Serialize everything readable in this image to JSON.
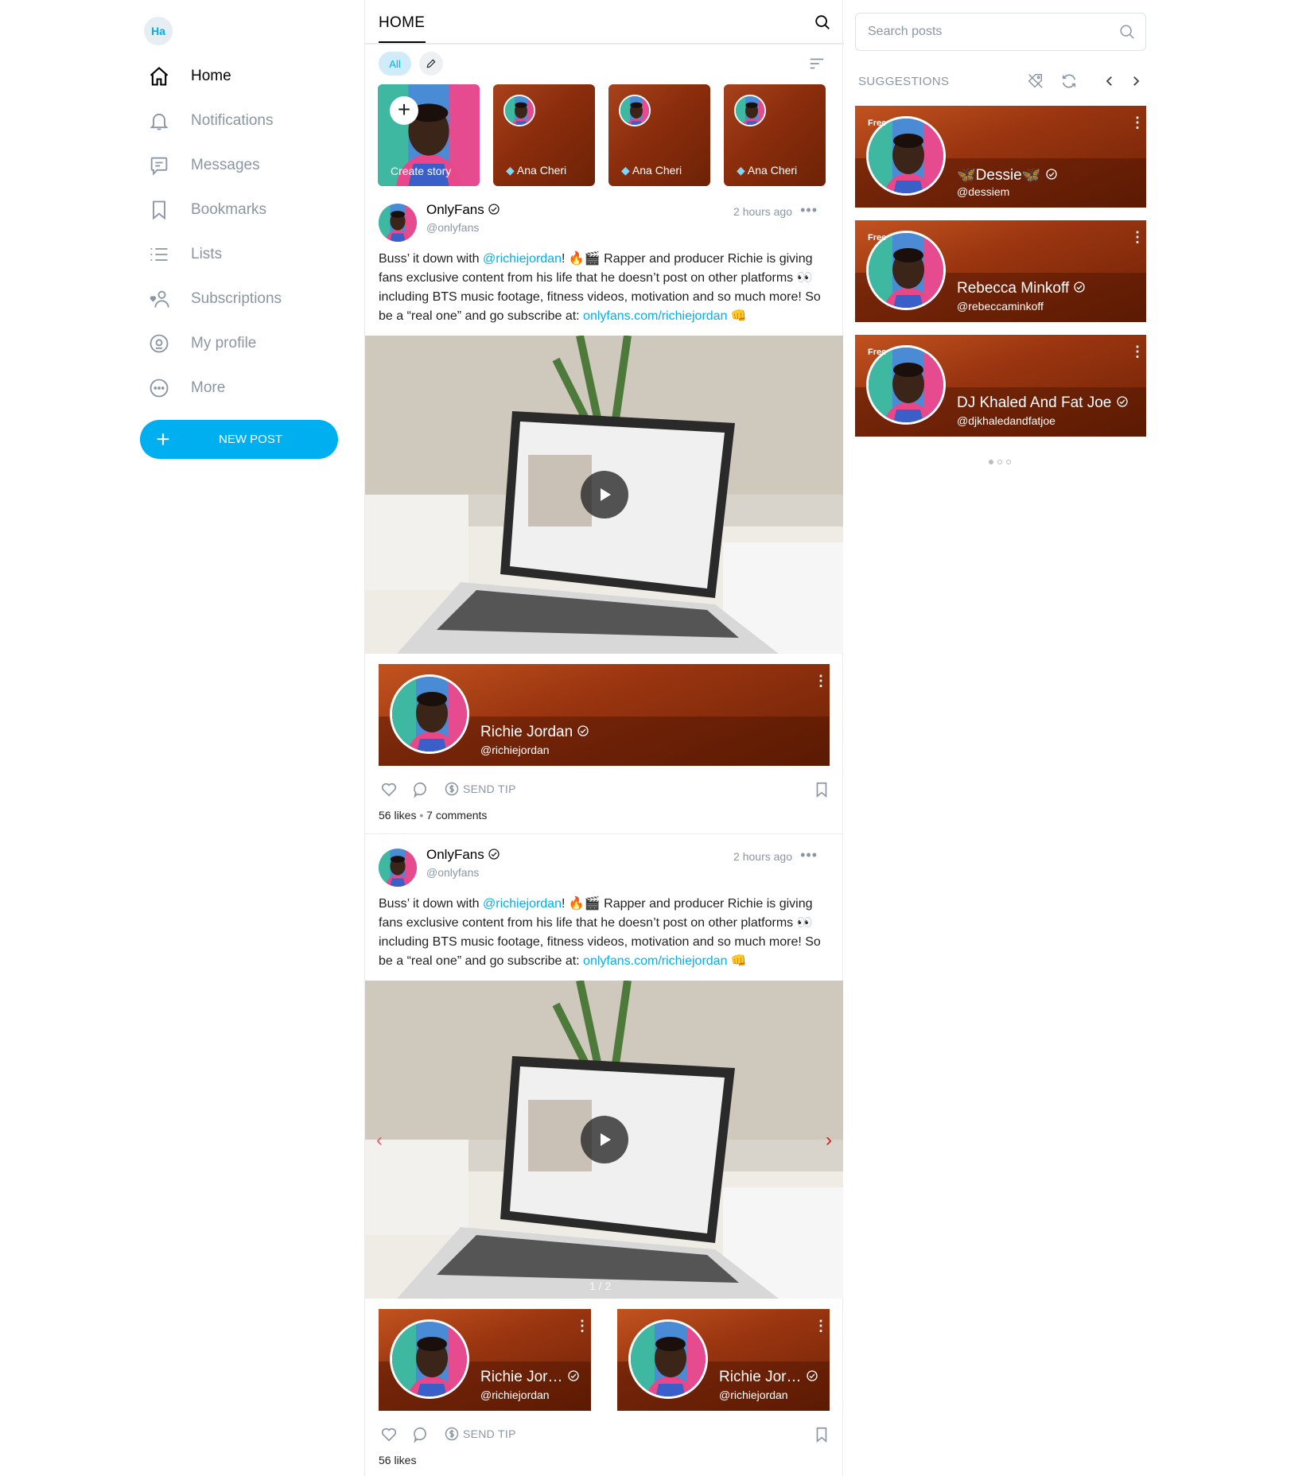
{
  "sidebar": {
    "avatar_initials": "Ha",
    "items": [
      {
        "label": "Home",
        "icon": "home-icon"
      },
      {
        "label": "Notifications",
        "icon": "bell-icon"
      },
      {
        "label": "Messages",
        "icon": "message-icon"
      },
      {
        "label": "Bookmarks",
        "icon": "bookmark-icon"
      },
      {
        "label": "Lists",
        "icon": "list-icon"
      },
      {
        "label": "Subscriptions",
        "icon": "subscriptions-icon"
      },
      {
        "label": "My profile",
        "icon": "profile-icon"
      },
      {
        "label": "More",
        "icon": "more-icon"
      }
    ],
    "new_post_label": "NEW POST"
  },
  "main": {
    "title": "HOME",
    "filter_all": "All",
    "stories": [
      {
        "label": "Create story"
      },
      {
        "label": "Ana Cheri"
      },
      {
        "label": "Ana Cheri"
      },
      {
        "label": "Ana Cheri"
      }
    ],
    "posts": [
      {
        "author": "OnlyFans",
        "handle": "@onlyfans",
        "time": "2 hours ago",
        "text_pre": "Buss’ it down with ",
        "mention": "@richiejordan",
        "text_mid": "! 🔥🎬 Rapper and producer Richie is giving fans exclusive content from his life that he doesn’t post on other platforms 👀 including BTS music footage, fitness videos, motivation and so much more! So be a “real one” and go subscribe at: ",
        "link": "onlyfans.com/richiejordan",
        "text_post": " 👊",
        "cards": [
          {
            "name": "Richie Jordan",
            "handle": "@richiejordan"
          }
        ],
        "send_tip": "SEND TIP",
        "likes": "56 likes",
        "comments": "7 comments"
      },
      {
        "author": "OnlyFans",
        "handle": "@onlyfans",
        "time": "2 hours ago",
        "text_pre": "Buss’ it down with ",
        "mention": "@richiejordan",
        "text_mid": "! 🔥🎬 Rapper and producer Richie is giving fans exclusive content from his life that he doesn’t post on other platforms 👀 including BTS music footage, fitness videos, motivation and so much more! So be a “real one” and go subscribe at: ",
        "link": "onlyfans.com/richiejordan",
        "text_post": " 👊",
        "media_counter": "1 / 2",
        "cards": [
          {
            "name": "Richie Jor…",
            "handle": "@richiejordan"
          },
          {
            "name": "Richie Jor…",
            "handle": "@richiejordan"
          }
        ],
        "send_tip": "SEND TIP",
        "likes": "56 likes"
      }
    ]
  },
  "right": {
    "search_placeholder": "Search posts",
    "suggestions_title": "SUGGESTIONS",
    "suggestions": [
      {
        "badge": "Free",
        "name": "🦋Dessie🦋",
        "handle": "@dessiem"
      },
      {
        "badge": "Free",
        "name": "Rebecca Minkoff",
        "handle": "@rebeccaminkoff"
      },
      {
        "badge": "Free",
        "name": "DJ Khaled And Fat Joe",
        "handle": "@djkhaledandfatjoe"
      }
    ]
  },
  "colors": {
    "accent": "#00aff0",
    "muted": "#8a96a3",
    "card_bg": "#8a2d0c"
  }
}
